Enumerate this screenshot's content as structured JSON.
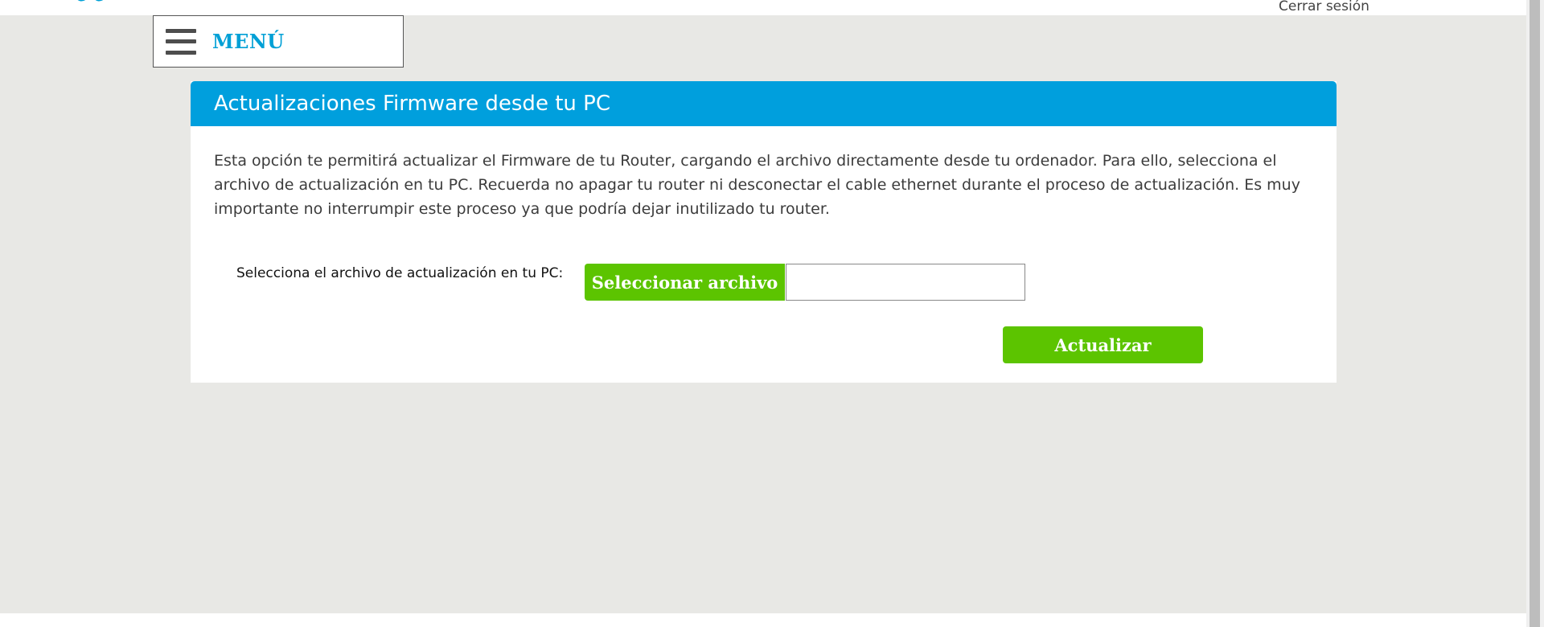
{
  "header": {
    "logout_label": "Cerrar sesión",
    "brand_color": "#00a0d6"
  },
  "menu": {
    "icon": "hamburger-icon",
    "label": "MENÚ"
  },
  "panel": {
    "title": "Actualizaciones Firmware desde tu PC",
    "header_color": "#009fdd",
    "description": "Esta opción te permitirá actualizar el Firmware de tu Router, cargando el archivo directamente desde tu ordenador. Para ello, selecciona el archivo de actualización en tu PC. Recuerda no apagar tu router ni desconectar el cable ethernet durante el proceso de actualización. Es muy importante no interrumpir este proceso ya que podría dejar inutilizado tu router."
  },
  "form": {
    "file_label": "Selecciona el archivo de actualización en tu PC:",
    "select_file_button": "Seleccionar archivo",
    "file_name_value": "",
    "update_button": "Actualizar",
    "button_color": "#5cc400"
  }
}
